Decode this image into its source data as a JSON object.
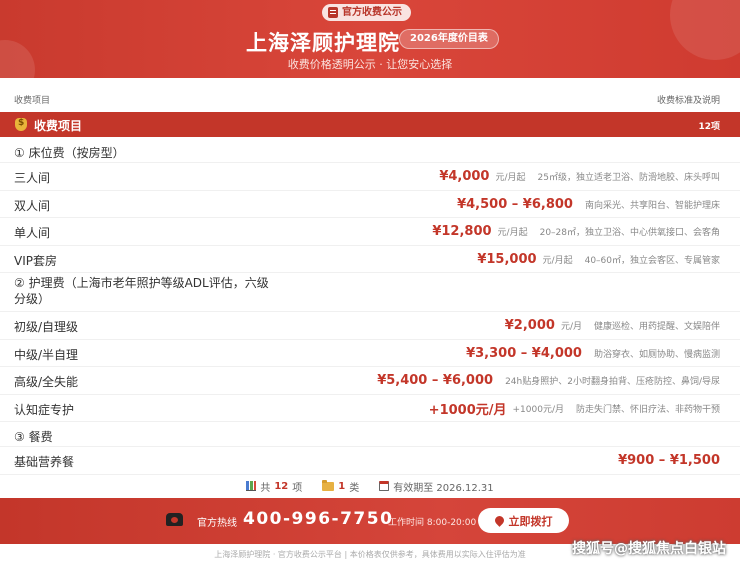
{
  "header": {
    "badge": "官方收费公示",
    "title": "上海泽顾护理院",
    "year_badge": "2026年度价目表",
    "subtitle": "收费价格透明公示 · 让您安心选择"
  },
  "columns": {
    "left": "收费项目",
    "right": "收费标准及说明"
  },
  "category": {
    "title": "收费项目",
    "count": "12项"
  },
  "rows": [
    {
      "type": "sub",
      "name": "① 床位费（按房型）"
    },
    {
      "name": "三人间",
      "price": "¥4,000",
      "unit": "元/月起",
      "desc": "25㎡级，独立适老卫浴、防滑地胶、床头呼叫"
    },
    {
      "name": "双人间",
      "price": "¥4,500 – ¥6,800",
      "unit": "",
      "desc": "南向采光、共享阳台、智能护理床"
    },
    {
      "name": "单人间",
      "price": "¥12,800",
      "unit": "元/月起",
      "desc": "20–28㎡，独立卫浴、中心供氧接口、会客角"
    },
    {
      "name": "VIP套房",
      "price": "¥15,000",
      "unit": "元/月起",
      "desc": "40–60㎡，独立会客区、专属管家"
    },
    {
      "type": "tall",
      "name": "② 护理费（上海市老年照护等级ADL评估，六级分级）"
    },
    {
      "name": "初级/自理级",
      "price": "¥2,000",
      "unit": "元/月",
      "desc": "健康巡检、用药提醒、文娱陪伴"
    },
    {
      "name": "中级/半自理",
      "price": "¥3,300 – ¥4,000",
      "unit": "",
      "desc": "助浴穿衣、如厕协助、慢病监测"
    },
    {
      "name": "高级/全失能",
      "price": "¥5,400 – ¥6,000",
      "unit": "",
      "desc": "24h贴身照护、2小时翻身拍背、压疮防控、鼻饲/导尿"
    },
    {
      "name": "认知症专护",
      "price": "+1000元/月",
      "unit": "+1000元/月",
      "desc": "防走失门禁、怀旧疗法、非药物干预"
    },
    {
      "type": "sub",
      "name": "③ 餐费"
    },
    {
      "name": "基础营养餐",
      "price": "¥900 – ¥1,500",
      "unit": "",
      "desc": ""
    }
  ],
  "summary": {
    "total_prefix": "共",
    "total_num": "12",
    "total_suffix": "项",
    "cat_num": "1",
    "cat_suffix": "类",
    "valid": "有效期至 2026.12.31"
  },
  "footer": {
    "hotline_label": "官方热线",
    "hotline": "400-996-7750",
    "hours": "工作时间 8:00-20:00",
    "call_button": "立即拨打"
  },
  "copyright": "上海泽顾护理院 · 官方收费公示平台  |  本价格表仅供参考，具体费用以实际入住评估为准",
  "watermark": "搜狐号@搜狐焦点白银站",
  "colors": {
    "brand": "#c33629",
    "accent_gold": "#e9b53a"
  }
}
